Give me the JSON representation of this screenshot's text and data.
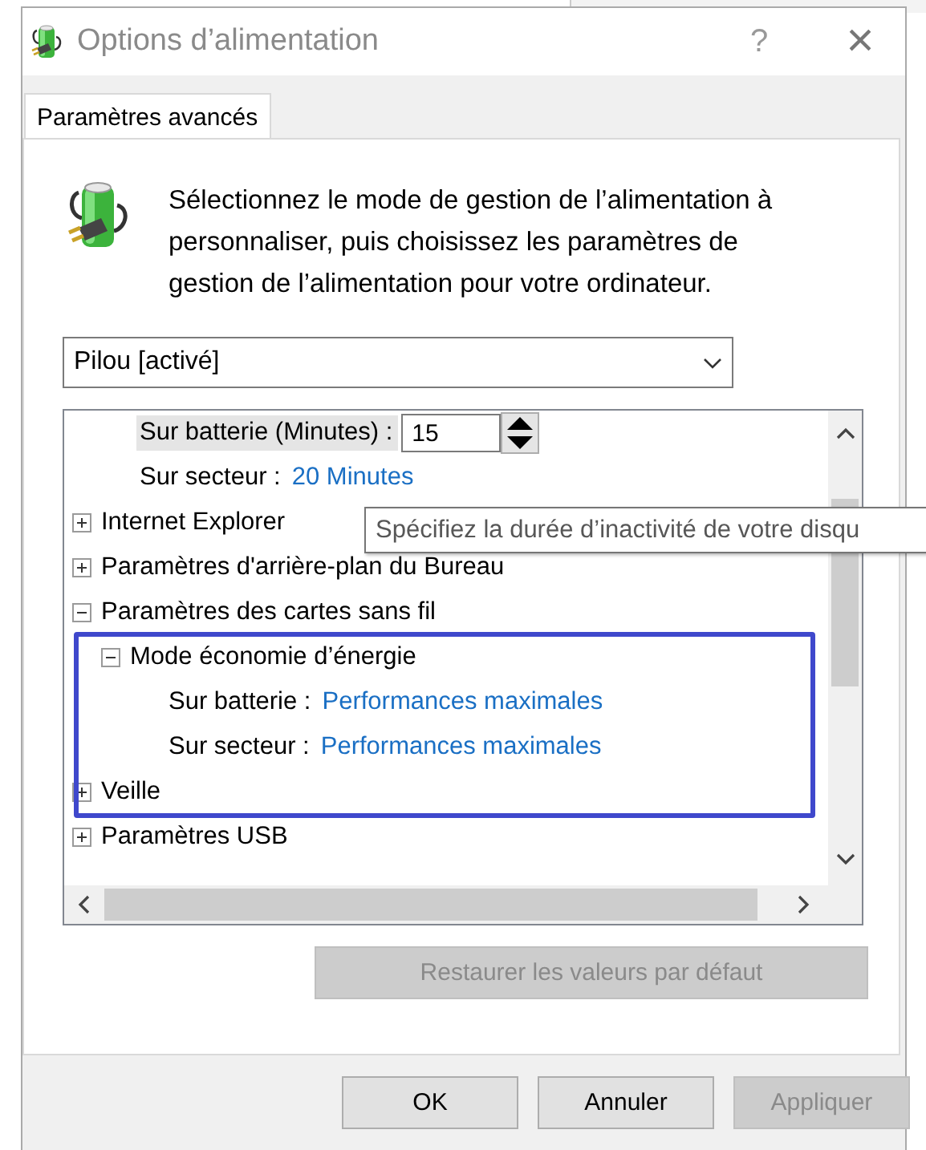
{
  "window": {
    "title": "Options d’alimentation",
    "help": "?",
    "close": "×"
  },
  "tabs": [
    {
      "label": "Paramètres avancés",
      "selected": true
    }
  ],
  "intro": "Sélectionnez le mode de gestion de l’alimentation à personnaliser, puis choisissez les paramètres de gestion de l’alimentation pour votre ordinateur.",
  "plan_dropdown": {
    "value": "Pilou [activé]"
  },
  "tree": {
    "continued_settings": [
      {
        "label": "Sur batterie (Minutes) :",
        "value": "15",
        "kind": "spinner",
        "selected": true
      },
      {
        "label": "Sur secteur :",
        "value": "20 Minutes",
        "kind": "link",
        "selected": false
      }
    ],
    "items": [
      {
        "label": "Internet Explorer",
        "expanded": false
      },
      {
        "label": "Paramètres d'arrière-plan du Bureau",
        "expanded": false
      },
      {
        "label": "Paramètres des cartes sans fil",
        "expanded": true,
        "children": [
          {
            "label": "Mode économie d’énergie",
            "expanded": true,
            "settings": [
              {
                "label": "Sur batterie :",
                "value": "Performances maximales",
                "kind": "link",
                "selected": false
              },
              {
                "label": "Sur secteur :",
                "value": "Performances maximales",
                "kind": "link",
                "selected": false
              }
            ]
          }
        ]
      },
      {
        "label": "Veille",
        "expanded": false
      },
      {
        "label": "Paramètres USB",
        "expanded": false
      }
    ]
  },
  "tooltip": "Spécifiez la durée d’inactivité de votre disqu",
  "restore_button": {
    "label": "Restaurer les valeurs par défaut",
    "disabled": true
  },
  "buttons": [
    {
      "label": "OK",
      "disabled": false
    },
    {
      "label": "Annuler",
      "disabled": false
    },
    {
      "label": "Appliquer",
      "disabled": true
    }
  ]
}
